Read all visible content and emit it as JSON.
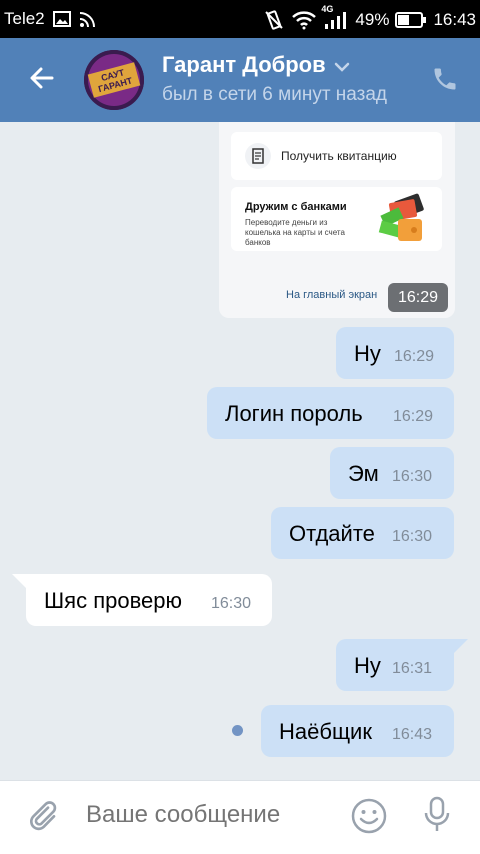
{
  "status_bar": {
    "carrier": "Tele2",
    "network": "4G",
    "battery": "49%",
    "time": "16:43",
    "icons": [
      "image-icon",
      "cast-icon",
      "vibrate-icon",
      "wifi-icon",
      "signal-icon",
      "battery-icon"
    ]
  },
  "header": {
    "contact_name": "Гарант Добров",
    "status": "был в сети 6 минут назад",
    "avatar_text": "САУТ ГАРАНТ",
    "icons": [
      "back-arrow-icon",
      "chevron-down-icon",
      "phone-icon"
    ]
  },
  "card": {
    "receipt_label": "Получить квитанцию",
    "bank_title": "Дружим с банками",
    "bank_desc": "Переводите деньги из кошелька на карты и счета банков",
    "link": "На главный экран",
    "time": "16:29"
  },
  "messages": [
    {
      "dir": "out",
      "text": "Ну",
      "time": "16:29"
    },
    {
      "dir": "out",
      "text": "Логин пороль",
      "time": "16:29"
    },
    {
      "dir": "out",
      "text": "Эм",
      "time": "16:30"
    },
    {
      "dir": "out",
      "text": "Отдайте",
      "time": "16:30"
    },
    {
      "dir": "in",
      "text": "Шяс проверю",
      "time": "16:30"
    },
    {
      "dir": "out",
      "text": "Ну",
      "time": "16:31"
    },
    {
      "dir": "out",
      "text": "Наёбщик",
      "time": "16:43"
    }
  ],
  "composer": {
    "placeholder": "Ваше сообщение",
    "icons": [
      "paperclip-icon",
      "emoji-icon",
      "microphone-icon"
    ]
  },
  "colors": {
    "header": "#5181b8",
    "outgoing_bubble": "#cce0f6",
    "incoming_bubble": "#ffffff",
    "chat_background": "#e7ecf0"
  }
}
